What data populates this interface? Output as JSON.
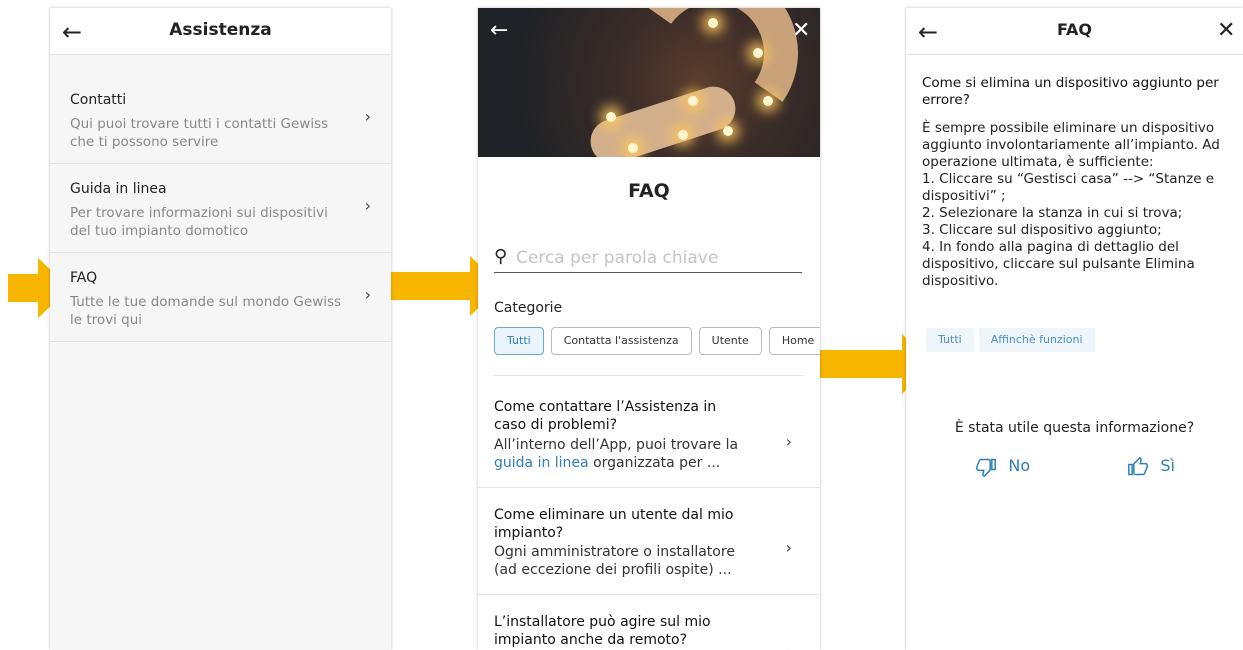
{
  "colors": {
    "accent": "#2e7fb8",
    "arrow": "#f7b500",
    "muted": "#888888"
  },
  "screen1": {
    "title": "Assistenza",
    "back_icon": "arrow-left-icon",
    "items": [
      {
        "title": "Contatti",
        "subtitle": "Qui puoi trovare tutti i contatti Gewiss che ti possono servire"
      },
      {
        "title": "Guida in linea",
        "subtitle": "Per trovare informazioni sui dispositivi del tuo impianto domotico"
      },
      {
        "title": "FAQ",
        "subtitle": "Tutte le tue domande sul mondo Gewiss le trovi qui"
      }
    ]
  },
  "screen2": {
    "title": "FAQ",
    "search_placeholder": "Cerca per parola chiave",
    "categories_label": "Categorie",
    "chips": [
      "Tutti",
      "Contatta l'assistenza",
      "Utente",
      "Home"
    ],
    "active_chip": "Tutti",
    "faqs": [
      {
        "question": "Come contattare l’Assistenza in caso di problemi?",
        "answer_pre": "All’interno dell’App, puoi trovare la ",
        "answer_link": "guida in linea",
        "answer_post": " organizzata per ..."
      },
      {
        "question": "Come eliminare un utente dal mio impianto?",
        "answer_pre": "Ogni amministratore o installatore (ad eccezione dei profili ospite) ...",
        "answer_link": "",
        "answer_post": ""
      },
      {
        "question": "L’installatore può agire sul mio impianto anche da remoto?",
        "answer_pre": "",
        "answer_link": "",
        "answer_post": ""
      }
    ]
  },
  "screen3": {
    "title": "FAQ",
    "question": "Come si elimina un dispositivo aggiunto per errore?",
    "answer": "È sempre possibile eliminare un dispositivo aggiunto involontariamente all’impianto. Ad operazione ultimata, è sufficiente:\n1. Cliccare su “Gestisci casa” --> “Stanze e dispositivi” ;\n2. Selezionare la stanza in cui si trova;\n3. Cliccare sul dispositivo aggiunto;\n4. In fondo alla pagina di dettaglio del dispositivo, cliccare sul pulsante Elimina dispositivo.",
    "tags": [
      "Tutti",
      "Affinchè funzioni"
    ],
    "feedback_question": "È stata utile questa informazione?",
    "vote_no": "No",
    "vote_yes": "Sì"
  }
}
